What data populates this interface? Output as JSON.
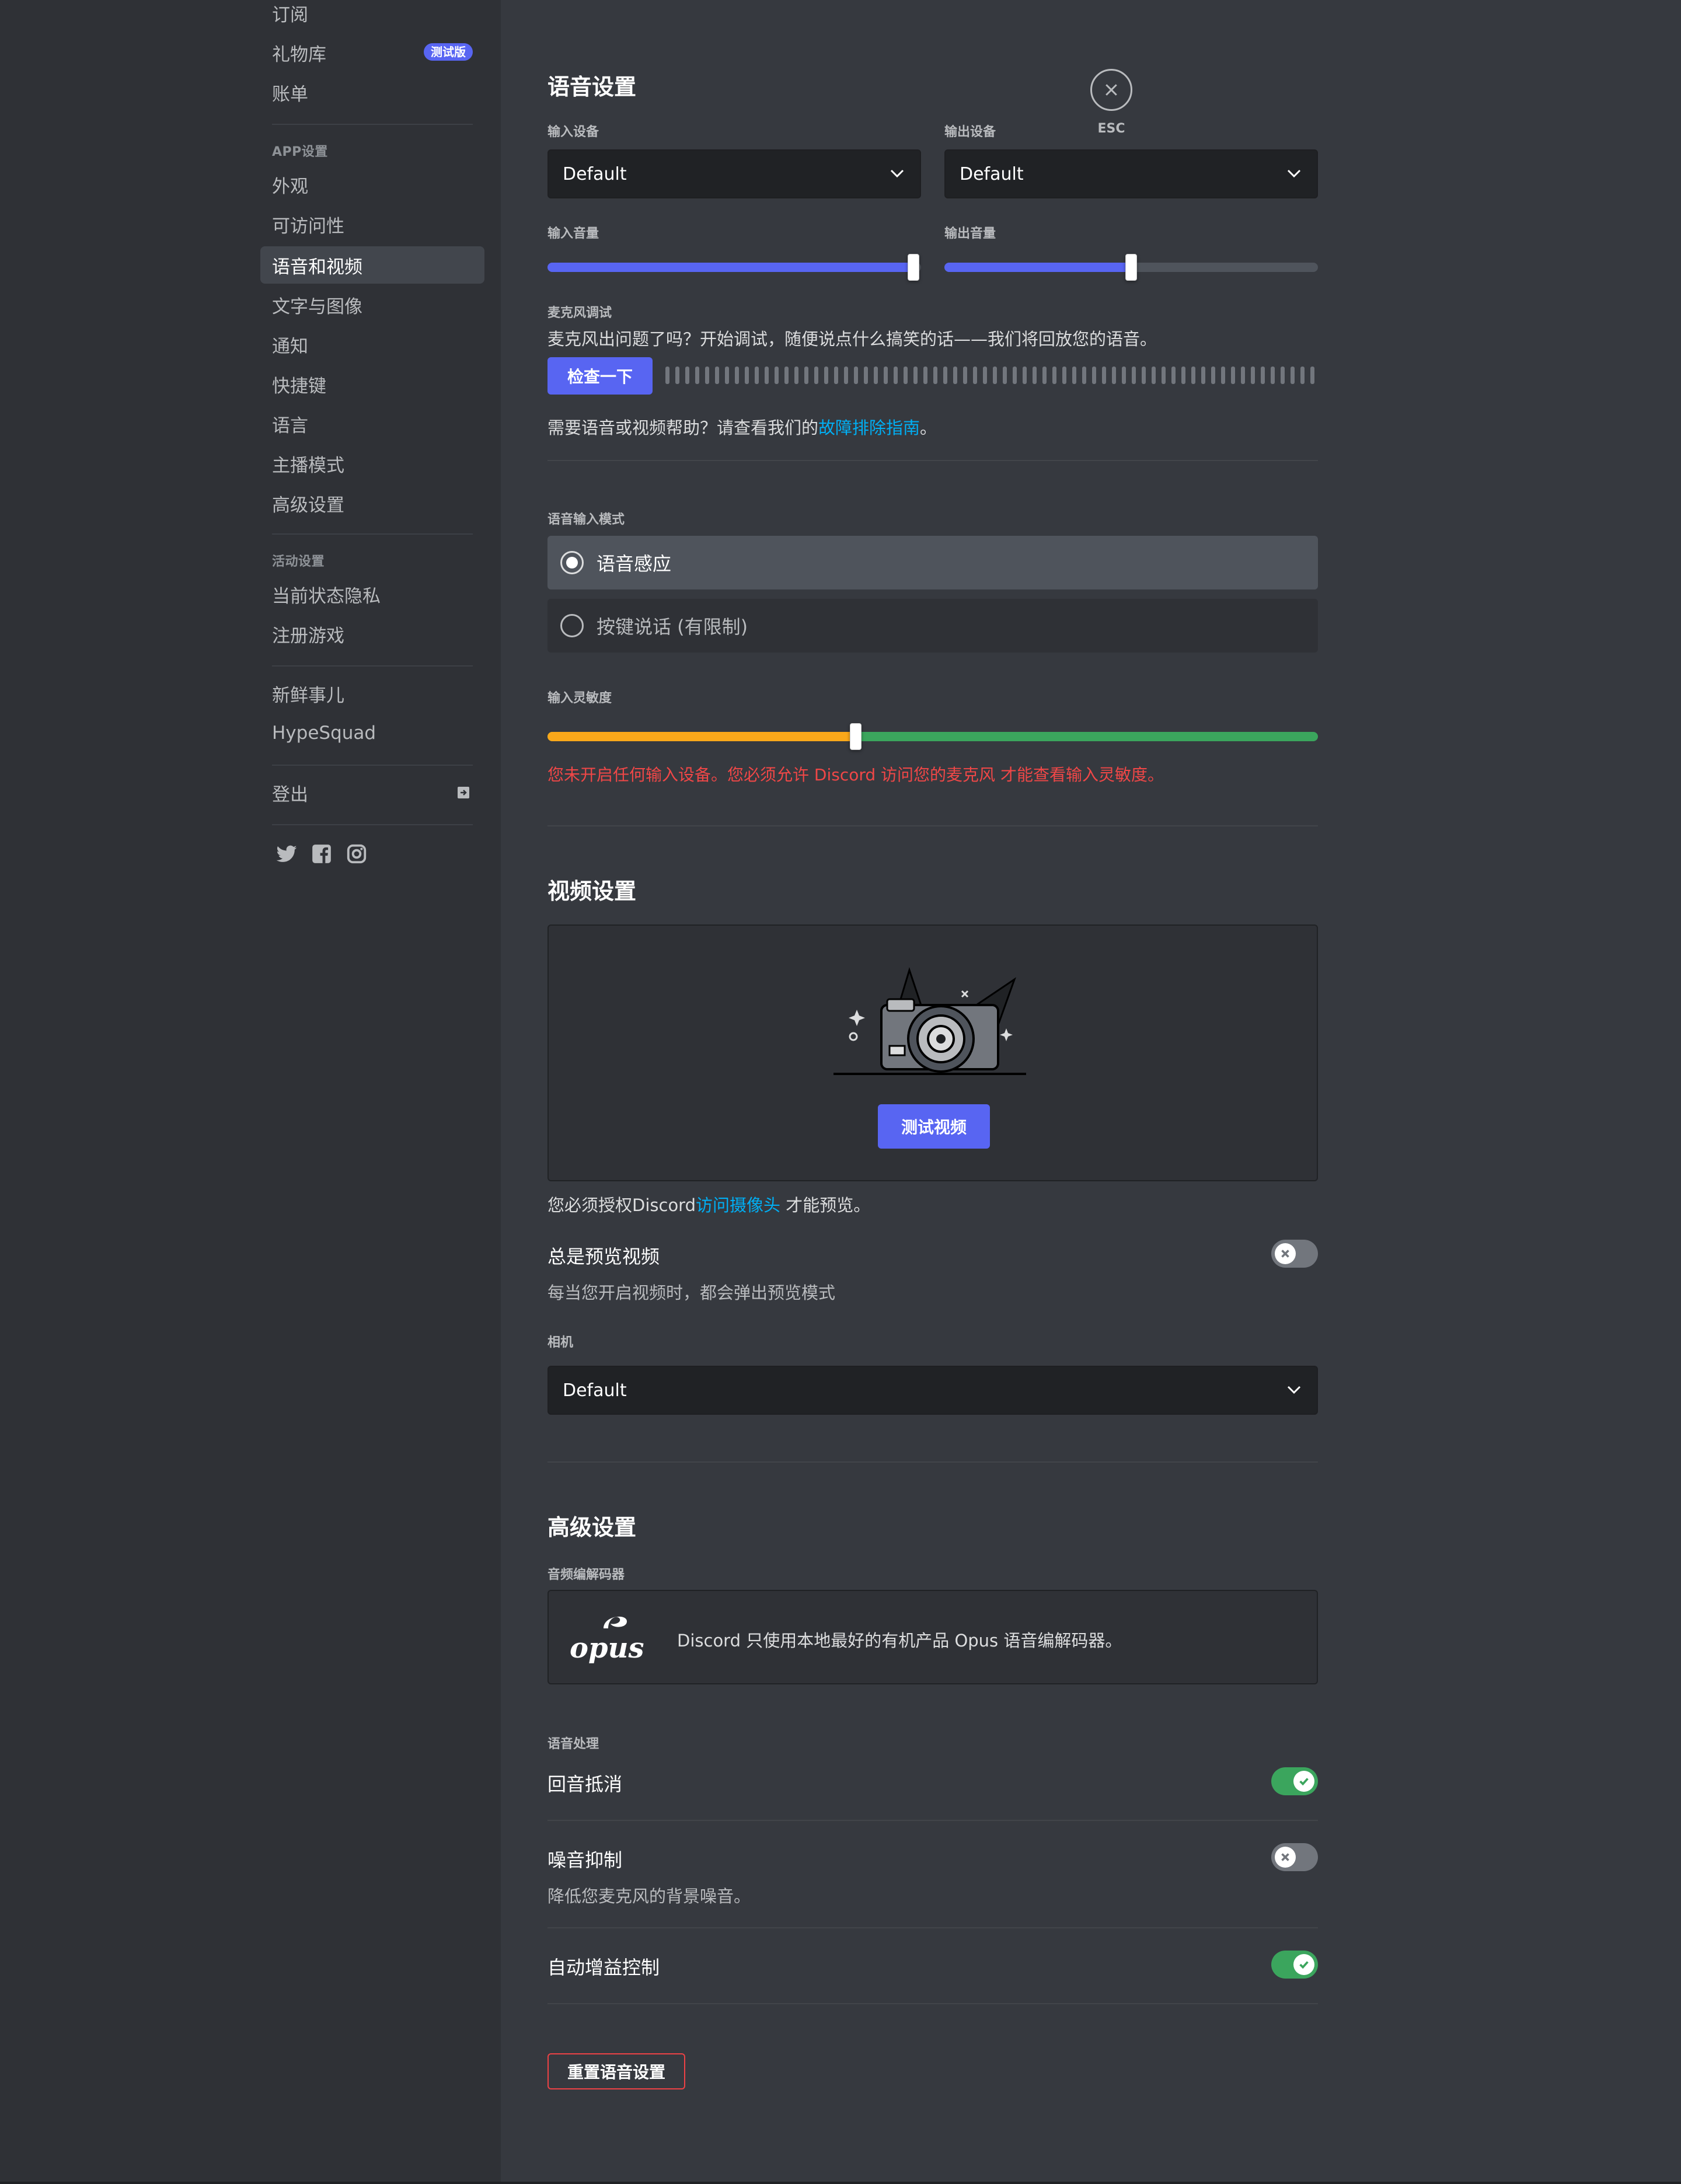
{
  "sidebar": {
    "items_top": [
      "订阅",
      "礼物库",
      "账单"
    ],
    "beta_badge": "测试版",
    "app_header": "APP设置",
    "app_items": [
      "外观",
      "可访问性",
      "语音和视频",
      "文字与图像",
      "通知",
      "快捷键",
      "语言",
      "主播模式",
      "高级设置"
    ],
    "activity_header": "活动设置",
    "activity_items": [
      "当前状态隐私",
      "注册游戏"
    ],
    "misc_items": [
      "新鲜事儿",
      "HypeSquad"
    ],
    "logout": "登出"
  },
  "esc_label": "ESC",
  "voice": {
    "title": "语音设置",
    "input_device_label": "输入设备",
    "input_device_value": "Default",
    "output_device_label": "输出设备",
    "output_device_value": "Default",
    "input_volume_label": "输入音量",
    "input_volume_percent": 98,
    "output_volume_label": "输出音量",
    "output_volume_percent": 50,
    "mic_test_label": "麦克风调试",
    "mic_test_desc": "麦克风出问题了吗？开始调试，随便说点什么搞笑的话——我们将回放您的语音。",
    "check_button": "检查一下",
    "help_text": "需要语音或视频帮助？请查看我们的",
    "help_link": "故障排除指南",
    "help_end": "。",
    "input_mode_label": "语音输入模式",
    "mode_voice_activity": "语音感应",
    "mode_ptt": "按键说话 (有限制)",
    "sensitivity_label": "输入灵敏度",
    "sensitivity_percent": 40,
    "sensitivity_warning": "您未开启任何输入设备。您必须允许 Discord 访问您的麦克风 才能查看输入灵敏度。"
  },
  "video": {
    "title": "视频设置",
    "test_button": "测试视频",
    "auth_text": "您必须授权Discord",
    "auth_link": "访问摄像头",
    "auth_end": " 才能预览。",
    "always_preview_title": "总是预览视频",
    "always_preview_desc": "每当您开启视频时，都会弹出预览模式",
    "always_preview_on": false,
    "camera_label": "相机",
    "camera_value": "Default"
  },
  "advanced": {
    "title": "高级设置",
    "codec_label": "音频编解码器",
    "codec_logo": "opus",
    "codec_desc": "Discord 只使用本地最好的有机产品 Opus 语音编解码器。",
    "processing_label": "语音处理",
    "echo_cancel": "回音抵消",
    "echo_cancel_on": true,
    "noise_suppression": "噪音抑制",
    "noise_suppression_desc": "降低您麦克风的背景噪音。",
    "noise_suppression_on": false,
    "agc": "自动增益控制",
    "agc_on": true,
    "reset_button": "重置语音设置"
  },
  "colors": {
    "blurple": "#5865f2",
    "green": "#3ba55d",
    "yellow": "#faa81a",
    "red_text": "#f04747",
    "link": "#00aff4"
  }
}
